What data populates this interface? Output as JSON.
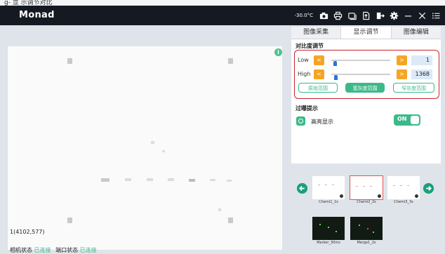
{
  "top_fragment": "g- 显 示调节对比",
  "app": {
    "brand": "Monad",
    "temperature": "-30.0°C"
  },
  "toolbar_icons": [
    "camera-icon",
    "printer-icon",
    "window-icon",
    "export-icon",
    "exit-icon",
    "gear-icon",
    "minimize-icon",
    "close-icon",
    "menu-icon"
  ],
  "tabs": [
    {
      "label": "图像采集",
      "active": false
    },
    {
      "label": "显示调节",
      "active": true
    },
    {
      "label": "图像编辑",
      "active": false
    }
  ],
  "contrast": {
    "title": "对比度调节",
    "low": {
      "label": "Low",
      "dec": "<",
      "inc": ">",
      "value": "1",
      "level": 0.03
    },
    "high": {
      "label": "High",
      "dec": "<",
      "inc": ">",
      "value": "1368",
      "level": 0.05
    },
    "ranges": [
      {
        "label": "原始范围",
        "active": false
      },
      {
        "label": "宽灰度范围",
        "active": true
      },
      {
        "label": "窄灰度范围",
        "active": false
      }
    ]
  },
  "overexposure": {
    "title": "过曝提示",
    "highlight_label": "高亮显示",
    "toggle_label": "ON",
    "on": true
  },
  "canvas": {
    "info_icon": "i",
    "coordinate": "1(4102,577)"
  },
  "status": {
    "camera_label": "相机状态",
    "camera_value": "已连接",
    "port_label": "端口状态",
    "port_value": "已连接"
  },
  "gallery": {
    "row1": [
      {
        "caption": "Chemi1_1s",
        "selected": false
      },
      {
        "caption": "Chemi2_2s",
        "selected": true
      },
      {
        "caption": "Chemi3_3s",
        "selected": false
      }
    ],
    "row2": [
      {
        "caption": "Marker_30ms",
        "selected": false
      },
      {
        "caption": "Merge1_2s",
        "selected": false
      }
    ]
  },
  "colors": {
    "accent": "#3cb98a",
    "orange": "#f5a524",
    "highlight_border": "#c8232c",
    "titlebar": "#151a22"
  }
}
